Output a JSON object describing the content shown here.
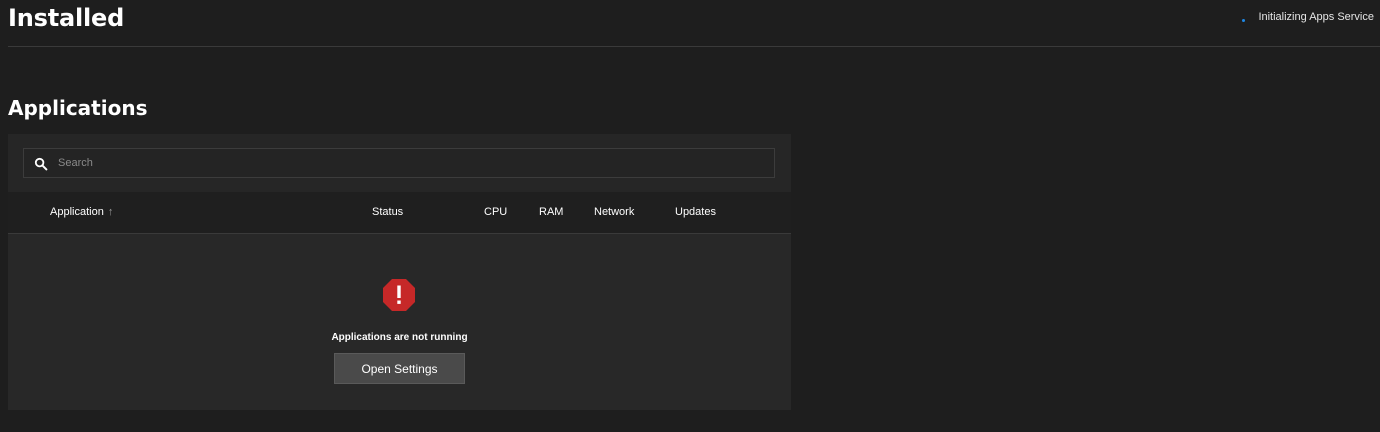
{
  "page": {
    "title": "Installed"
  },
  "service_status": {
    "text": "Initializing Apps Service",
    "spinner_color": "#1e88e5"
  },
  "section": {
    "title": "Applications"
  },
  "search": {
    "placeholder": "Search",
    "value": "",
    "icon": "search-icon"
  },
  "table": {
    "columns": [
      {
        "label": "Application",
        "sort": "ascending"
      },
      {
        "label": "Status"
      },
      {
        "label": "CPU"
      },
      {
        "label": "RAM"
      },
      {
        "label": "Network"
      },
      {
        "label": "Updates"
      }
    ]
  },
  "empty_state": {
    "icon": "error-octagon-icon",
    "icon_color": "#c62828",
    "message": "Applications are not running",
    "button_label": "Open Settings"
  }
}
